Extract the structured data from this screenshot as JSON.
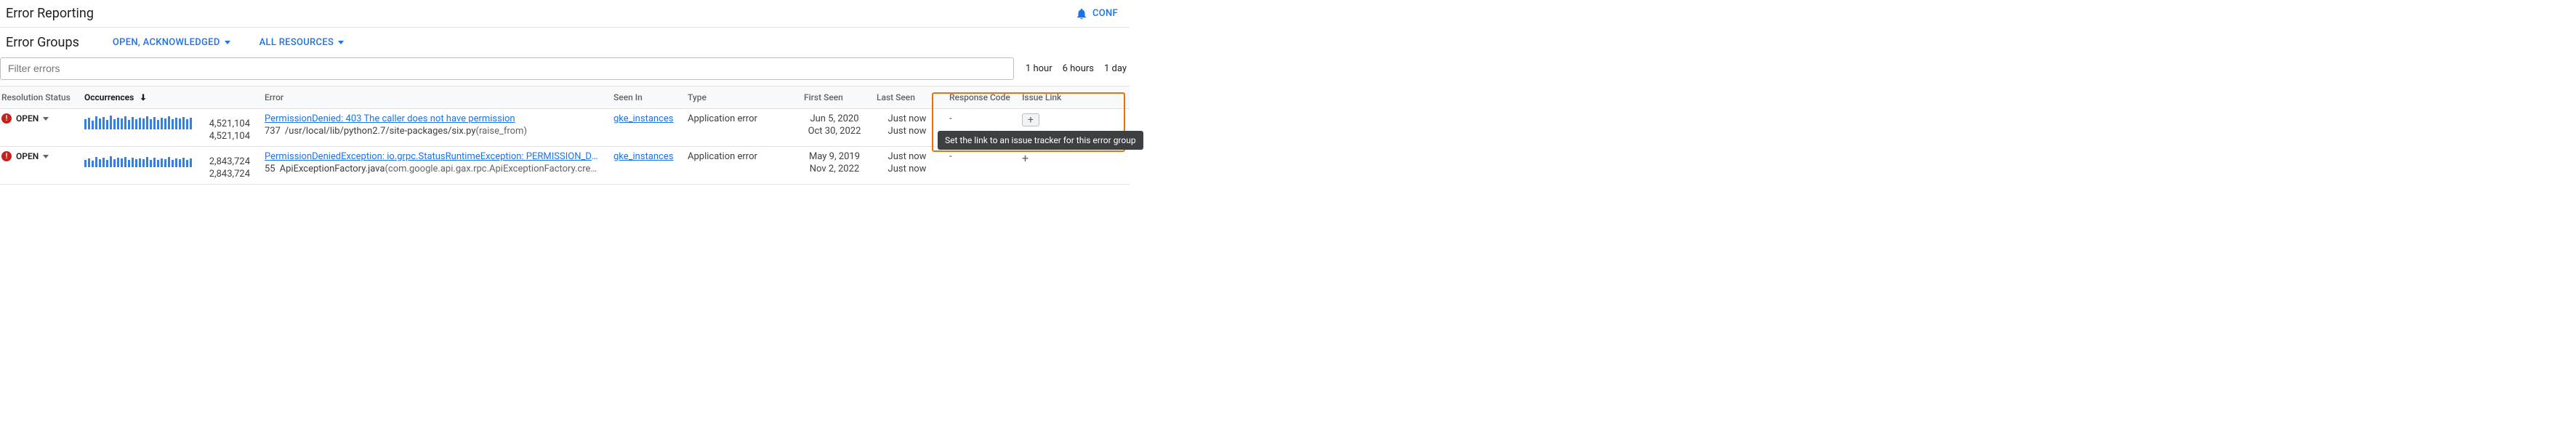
{
  "header": {
    "title": "Error Reporting",
    "config_label": "CONF"
  },
  "subheader": {
    "section_title": "Error Groups",
    "status_filter": "OPEN, ACKNOWLEDGED",
    "resource_filter": "ALL RESOURCES"
  },
  "filter": {
    "placeholder": "Filter errors"
  },
  "time_tabs": [
    "1 hour",
    "6 hours",
    "1 day"
  ],
  "columns": {
    "status": "Resolution Status",
    "occ": "Occurrences",
    "error": "Error",
    "seenin": "Seen In",
    "type": "Type",
    "first": "First Seen",
    "last": "Last Seen",
    "resp": "Response Code",
    "issue": "Issue Link"
  },
  "rows": [
    {
      "status": "OPEN",
      "occ_top": "4,521,104",
      "occ_bottom": "4,521,104",
      "err_link": "PermissionDenied: 403 The caller does not have permission",
      "err_line": "737",
      "err_path": "/usr/local/lib/python2.7/site-packages/six.py",
      "err_fn": "(raise_from)",
      "seen_in": "gke_instances",
      "type": "Application error",
      "first_top": "Jun 5, 2020",
      "first_bottom": "Oct 30, 2022",
      "last_top": "Just now",
      "last_bottom": "Just now",
      "resp": "-"
    },
    {
      "status": "OPEN",
      "occ_top": "2,843,724",
      "occ_bottom": "2,843,724",
      "err_link": "PermissionDeniedException: io.grpc.StatusRuntimeException: PERMISSION_DENIED: T…",
      "err_line": "55",
      "err_path": "ApiExceptionFactory.java",
      "err_fn": "(com.google.api.gax.rpc.ApiExceptionFactory.createExcep…",
      "seen_in": "gke_instances",
      "type": "Application error",
      "first_top": "May 9, 2019",
      "first_bottom": "Nov 2, 2022",
      "last_top": "Just now",
      "last_bottom": "Just now",
      "resp": "-"
    }
  ],
  "tooltip": "Set the link to an issue tracker for this error group"
}
